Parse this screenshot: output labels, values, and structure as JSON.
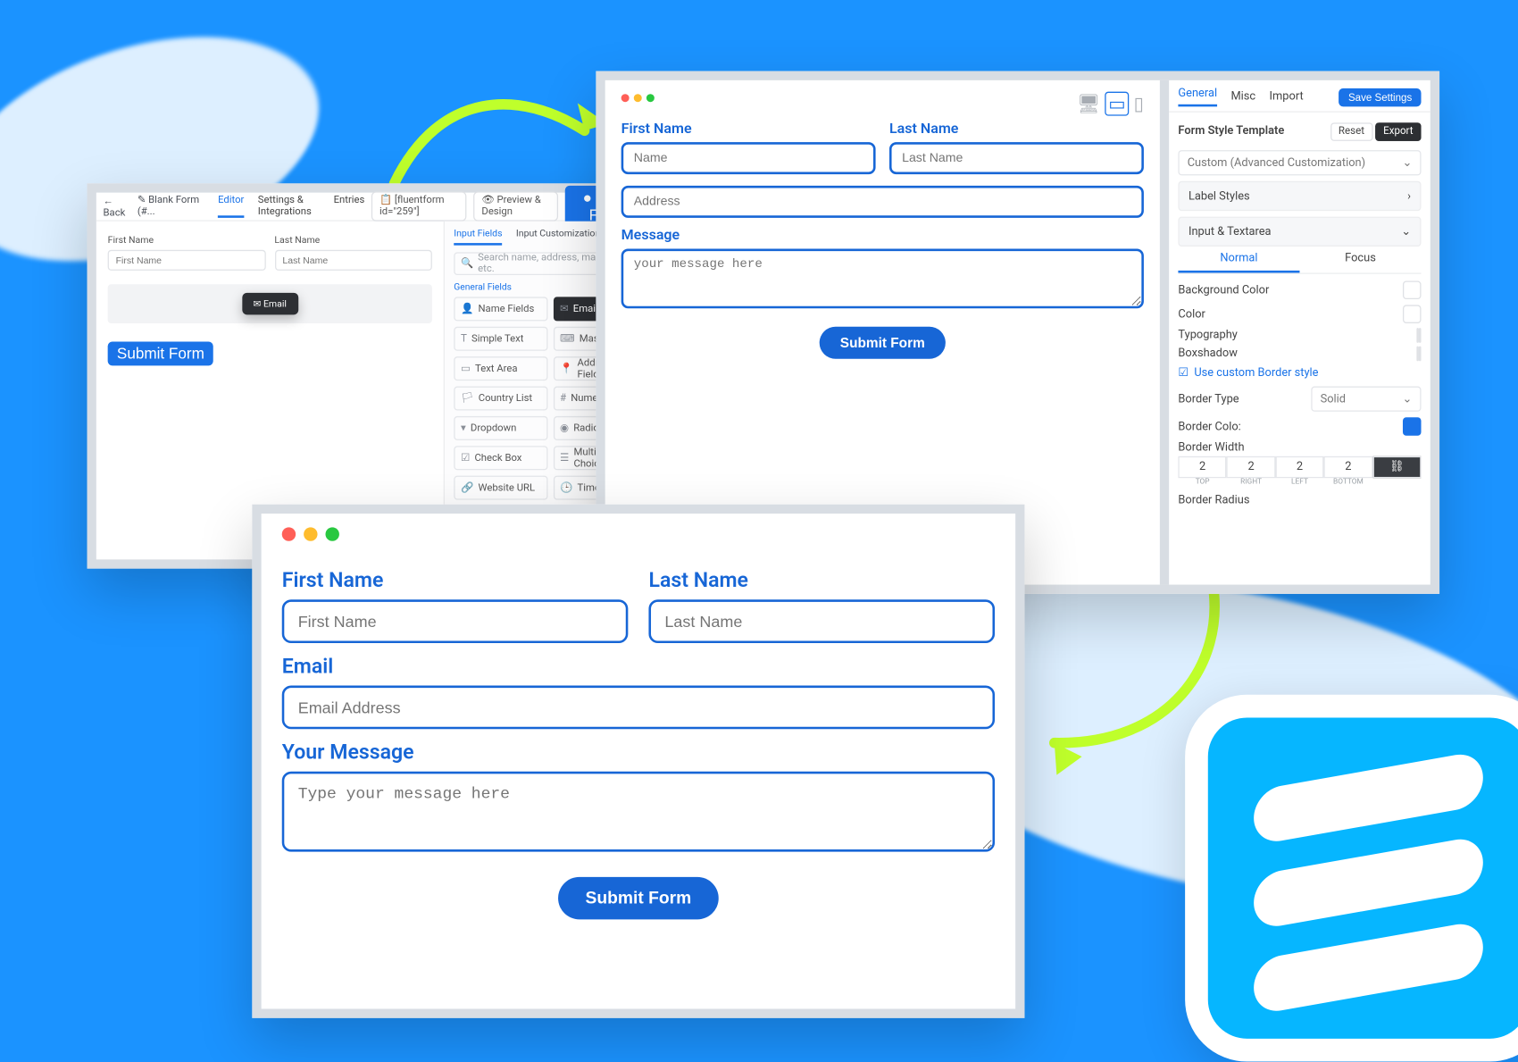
{
  "editor": {
    "back": "Back",
    "crumb": "Blank Form  (#...",
    "nav": {
      "editor": "Editor",
      "settings": "Settings & Integrations",
      "entries": "Entries"
    },
    "shortcode": "[fluentform id=\"259\"]",
    "preview": "Preview & Design",
    "save": "Save Form",
    "fields": {
      "first_label": "First Name",
      "first_ph": "First Name",
      "last_label": "Last Name",
      "last_ph": "Last Name"
    },
    "drag_chip": "Email",
    "submit": "Submit Form",
    "side": {
      "tabs": {
        "input": "Input Fields",
        "custom": "Input Customization"
      },
      "search_ph": "Search name, address, mask input etc.",
      "section": "General Fields",
      "items": [
        "Name Fields",
        "Email",
        "Simple Text",
        "Mask Input",
        "Text Area",
        "Address Fields",
        "Country List",
        "Numeric Field",
        "Dropdown",
        "Radio Field",
        "Check Box",
        "Multiple Choice",
        "Website URL",
        "Time & Date"
      ]
    }
  },
  "preview": {
    "labels": {
      "first": "First Name",
      "last": "Last Name",
      "email": "",
      "msg": "Message"
    },
    "ph": {
      "first": "Name",
      "last": "Last Name",
      "email": "Address",
      "msg": "your message here"
    },
    "submit": "Submit Form"
  },
  "style": {
    "tabs": {
      "general": "General",
      "misc": "Misc",
      "import": "Import"
    },
    "save": "Save Settings",
    "title": "Form Style Template",
    "reset": "Reset",
    "export": "Export",
    "template": "Custom (Advanced Customization)",
    "acc": {
      "label": "Label Styles",
      "input": "Input & Textarea"
    },
    "subtabs": {
      "normal": "Normal",
      "focus": "Focus"
    },
    "rows": {
      "bg": "Background Color",
      "color": "Color",
      "typo": "Typography",
      "shadow": "Boxshadow"
    },
    "custom_border": "Use custom Border style",
    "btype": "Border Type",
    "btype_val": "Solid",
    "bcolor": "Border Colo:",
    "bwidth": "Border Width",
    "bradius": "Border Radius",
    "bwid": {
      "top": "2",
      "right": "2",
      "left": "2",
      "bottom": "2",
      "labs": [
        "TOP",
        "RIGHT",
        "LEFT",
        "BOTTOM"
      ]
    }
  },
  "final": {
    "labels": {
      "first": "First Name",
      "last": "Last Name",
      "email": "Email",
      "msg": "Your Message"
    },
    "ph": {
      "first": "First Name",
      "last": "Last Name",
      "email": "Email Address",
      "msg": "Type your message here"
    },
    "submit": "Submit Form"
  }
}
